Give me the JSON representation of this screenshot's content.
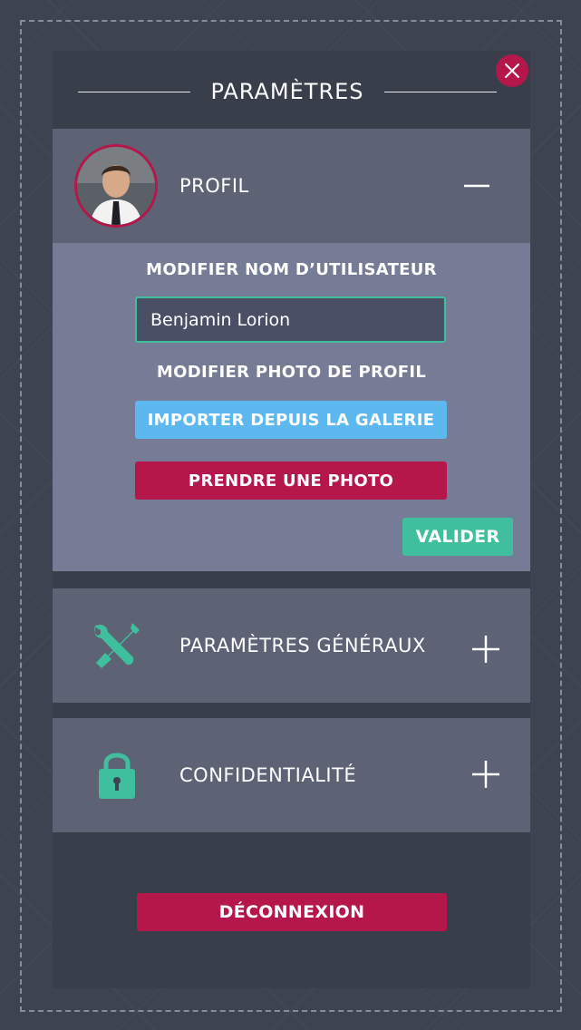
{
  "header": {
    "title": "PARAMÈTRES"
  },
  "profile": {
    "label": "PROFIL",
    "edit_name_heading": "MODIFIER NOM D’UTILISATEUR",
    "username_value": "Benjamin Lorion",
    "edit_photo_heading": "MODIFIER PHOTO DE PROFIL",
    "import_button": "IMPORTER DEPUIS LA GALERIE",
    "take_photo_button": "PRENDRE UNE PHOTO",
    "validate_button": "VALIDER"
  },
  "sections": {
    "general": {
      "label": "PARAMÈTRES GÉNÉRAUX",
      "icon": "tools-icon"
    },
    "privacy": {
      "label": "CONFIDENTIALITÉ",
      "icon": "lock-icon"
    }
  },
  "logout_button": "DÉCONNEXION",
  "colors": {
    "background": "#3d4350",
    "panel": "#393e4b",
    "section": "#5d6275",
    "profile_body": "#767c95",
    "accent_red": "#b5174a",
    "accent_green": "#3fbf9d",
    "accent_blue": "#5cb8ef"
  }
}
